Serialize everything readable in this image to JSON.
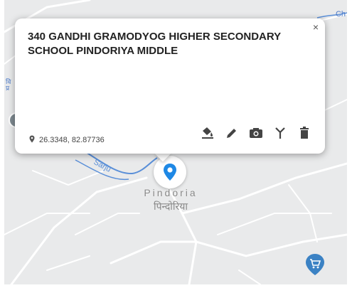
{
  "popup": {
    "title": "340 GANDHI GRAMODYOG HIGHER SECONDARY SCHOOL PINDORIYA MIDDLE",
    "coordinates": "26.3348, 82.87736",
    "close_glyph": "×",
    "tools": [
      {
        "icon": "paint-bucket-icon"
      },
      {
        "icon": "pencil-icon"
      },
      {
        "icon": "camera-icon"
      },
      {
        "icon": "merge-icon"
      },
      {
        "icon": "trash-icon"
      }
    ]
  },
  "map": {
    "place_name_en": "Pindoria",
    "place_name_hi": "पिन्दोरिया",
    "river_label": "Sarju",
    "edge_label": "Ch",
    "side_poi_label": "वि प्र",
    "colors": {
      "background": "#e9eaeb",
      "road": "#ffffff",
      "river": "#5a8fd8",
      "marker_primary": "#1e88e5",
      "marker_shop": "#3b82c4"
    }
  }
}
